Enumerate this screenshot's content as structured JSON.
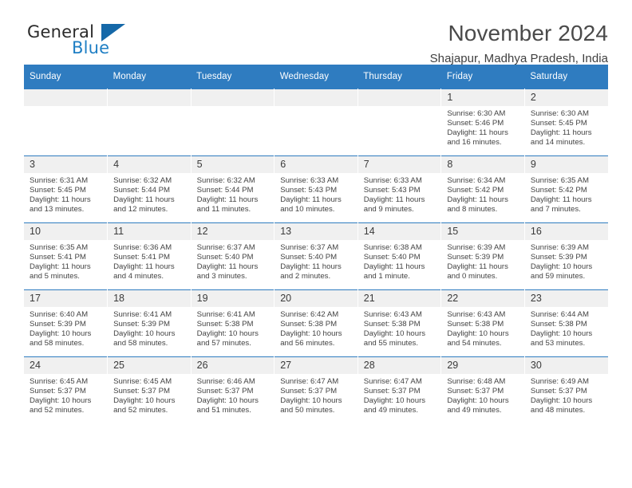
{
  "brand": {
    "name_part1": "General",
    "name_part2": "Blue",
    "triangle_color": "#1568a8",
    "blue_text_color": "#1f7fc4"
  },
  "header": {
    "title": "November 2024",
    "subtitle": "Shajapur, Madhya Pradesh, India"
  },
  "calendar": {
    "header_bg": "#2f7cc0",
    "daynum_bg": "#f0f0f0",
    "weekdays": [
      "Sunday",
      "Monday",
      "Tuesday",
      "Wednesday",
      "Thursday",
      "Friday",
      "Saturday"
    ],
    "weeks": [
      [
        {
          "day": "",
          "empty": true
        },
        {
          "day": "",
          "empty": true
        },
        {
          "day": "",
          "empty": true
        },
        {
          "day": "",
          "empty": true
        },
        {
          "day": "",
          "empty": true
        },
        {
          "day": "1",
          "sunrise": "Sunrise: 6:30 AM",
          "sunset": "Sunset: 5:46 PM",
          "daylight": "Daylight: 11 hours and 16 minutes."
        },
        {
          "day": "2",
          "sunrise": "Sunrise: 6:30 AM",
          "sunset": "Sunset: 5:45 PM",
          "daylight": "Daylight: 11 hours and 14 minutes."
        }
      ],
      [
        {
          "day": "3",
          "sunrise": "Sunrise: 6:31 AM",
          "sunset": "Sunset: 5:45 PM",
          "daylight": "Daylight: 11 hours and 13 minutes."
        },
        {
          "day": "4",
          "sunrise": "Sunrise: 6:32 AM",
          "sunset": "Sunset: 5:44 PM",
          "daylight": "Daylight: 11 hours and 12 minutes."
        },
        {
          "day": "5",
          "sunrise": "Sunrise: 6:32 AM",
          "sunset": "Sunset: 5:44 PM",
          "daylight": "Daylight: 11 hours and 11 minutes."
        },
        {
          "day": "6",
          "sunrise": "Sunrise: 6:33 AM",
          "sunset": "Sunset: 5:43 PM",
          "daylight": "Daylight: 11 hours and 10 minutes."
        },
        {
          "day": "7",
          "sunrise": "Sunrise: 6:33 AM",
          "sunset": "Sunset: 5:43 PM",
          "daylight": "Daylight: 11 hours and 9 minutes."
        },
        {
          "day": "8",
          "sunrise": "Sunrise: 6:34 AM",
          "sunset": "Sunset: 5:42 PM",
          "daylight": "Daylight: 11 hours and 8 minutes."
        },
        {
          "day": "9",
          "sunrise": "Sunrise: 6:35 AM",
          "sunset": "Sunset: 5:42 PM",
          "daylight": "Daylight: 11 hours and 7 minutes."
        }
      ],
      [
        {
          "day": "10",
          "sunrise": "Sunrise: 6:35 AM",
          "sunset": "Sunset: 5:41 PM",
          "daylight": "Daylight: 11 hours and 5 minutes."
        },
        {
          "day": "11",
          "sunrise": "Sunrise: 6:36 AM",
          "sunset": "Sunset: 5:41 PM",
          "daylight": "Daylight: 11 hours and 4 minutes."
        },
        {
          "day": "12",
          "sunrise": "Sunrise: 6:37 AM",
          "sunset": "Sunset: 5:40 PM",
          "daylight": "Daylight: 11 hours and 3 minutes."
        },
        {
          "day": "13",
          "sunrise": "Sunrise: 6:37 AM",
          "sunset": "Sunset: 5:40 PM",
          "daylight": "Daylight: 11 hours and 2 minutes."
        },
        {
          "day": "14",
          "sunrise": "Sunrise: 6:38 AM",
          "sunset": "Sunset: 5:40 PM",
          "daylight": "Daylight: 11 hours and 1 minute."
        },
        {
          "day": "15",
          "sunrise": "Sunrise: 6:39 AM",
          "sunset": "Sunset: 5:39 PM",
          "daylight": "Daylight: 11 hours and 0 minutes."
        },
        {
          "day": "16",
          "sunrise": "Sunrise: 6:39 AM",
          "sunset": "Sunset: 5:39 PM",
          "daylight": "Daylight: 10 hours and 59 minutes."
        }
      ],
      [
        {
          "day": "17",
          "sunrise": "Sunrise: 6:40 AM",
          "sunset": "Sunset: 5:39 PM",
          "daylight": "Daylight: 10 hours and 58 minutes."
        },
        {
          "day": "18",
          "sunrise": "Sunrise: 6:41 AM",
          "sunset": "Sunset: 5:39 PM",
          "daylight": "Daylight: 10 hours and 58 minutes."
        },
        {
          "day": "19",
          "sunrise": "Sunrise: 6:41 AM",
          "sunset": "Sunset: 5:38 PM",
          "daylight": "Daylight: 10 hours and 57 minutes."
        },
        {
          "day": "20",
          "sunrise": "Sunrise: 6:42 AM",
          "sunset": "Sunset: 5:38 PM",
          "daylight": "Daylight: 10 hours and 56 minutes."
        },
        {
          "day": "21",
          "sunrise": "Sunrise: 6:43 AM",
          "sunset": "Sunset: 5:38 PM",
          "daylight": "Daylight: 10 hours and 55 minutes."
        },
        {
          "day": "22",
          "sunrise": "Sunrise: 6:43 AM",
          "sunset": "Sunset: 5:38 PM",
          "daylight": "Daylight: 10 hours and 54 minutes."
        },
        {
          "day": "23",
          "sunrise": "Sunrise: 6:44 AM",
          "sunset": "Sunset: 5:38 PM",
          "daylight": "Daylight: 10 hours and 53 minutes."
        }
      ],
      [
        {
          "day": "24",
          "sunrise": "Sunrise: 6:45 AM",
          "sunset": "Sunset: 5:37 PM",
          "daylight": "Daylight: 10 hours and 52 minutes."
        },
        {
          "day": "25",
          "sunrise": "Sunrise: 6:45 AM",
          "sunset": "Sunset: 5:37 PM",
          "daylight": "Daylight: 10 hours and 52 minutes."
        },
        {
          "day": "26",
          "sunrise": "Sunrise: 6:46 AM",
          "sunset": "Sunset: 5:37 PM",
          "daylight": "Daylight: 10 hours and 51 minutes."
        },
        {
          "day": "27",
          "sunrise": "Sunrise: 6:47 AM",
          "sunset": "Sunset: 5:37 PM",
          "daylight": "Daylight: 10 hours and 50 minutes."
        },
        {
          "day": "28",
          "sunrise": "Sunrise: 6:47 AM",
          "sunset": "Sunset: 5:37 PM",
          "daylight": "Daylight: 10 hours and 49 minutes."
        },
        {
          "day": "29",
          "sunrise": "Sunrise: 6:48 AM",
          "sunset": "Sunset: 5:37 PM",
          "daylight": "Daylight: 10 hours and 49 minutes."
        },
        {
          "day": "30",
          "sunrise": "Sunrise: 6:49 AM",
          "sunset": "Sunset: 5:37 PM",
          "daylight": "Daylight: 10 hours and 48 minutes."
        }
      ]
    ]
  }
}
